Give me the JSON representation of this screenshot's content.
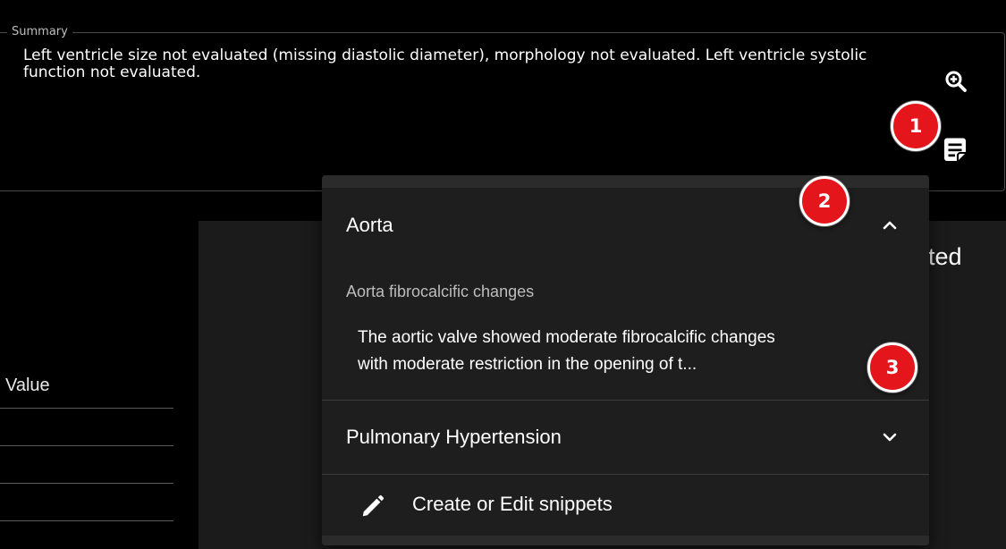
{
  "summary": {
    "legend": "Summary",
    "text": "Left ventricle size not evaluated (missing diastolic diameter), morphology not evaluated. Left ventricle systolic function not evaluated.",
    "zoom_icon": "zoom-in-icon",
    "notes_icon": "notes-icon"
  },
  "background": {
    "heading_fragment": "ted",
    "table_header": "Value"
  },
  "menu": {
    "sections": [
      {
        "title": "Aorta",
        "expanded": true,
        "snippets": [
          {
            "title": "Aorta fibrocalcific changes",
            "preview_line1": "The aortic valve showed moderate fibrocalcific changes",
            "preview_line2": "with moderate restriction in the opening of t..."
          }
        ]
      },
      {
        "title": "Pulmonary Hypertension",
        "expanded": false
      }
    ],
    "create_label": "Create or Edit snippets",
    "create_icon": "pencil-icon"
  },
  "markers": [
    "1",
    "2",
    "3"
  ],
  "colors": {
    "background": "#000000",
    "menu_bg": "#1e1e1e",
    "marker_red": "#e4161c",
    "text": "#ffffff",
    "muted_text": "#bdbdbd"
  }
}
